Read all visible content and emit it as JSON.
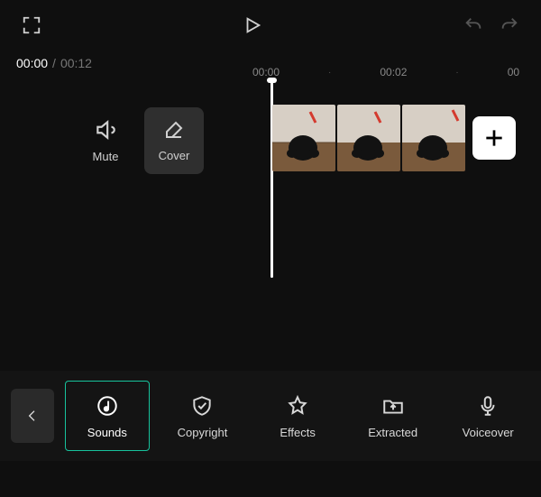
{
  "accent": "#17c29c",
  "timecode": {
    "current": "00:00",
    "duration": "00:12"
  },
  "ruler": {
    "ticks": [
      "00:00",
      "·",
      "00:02",
      "·",
      "00"
    ]
  },
  "track_controls": {
    "mute_label": "Mute",
    "cover_label": "Cover"
  },
  "toolbar": {
    "items": [
      {
        "label": "Sounds"
      },
      {
        "label": "Copyright"
      },
      {
        "label": "Effects"
      },
      {
        "label": "Extracted"
      },
      {
        "label": "Voiceover"
      }
    ]
  },
  "clips": {
    "count": 3
  },
  "add_label": "+"
}
